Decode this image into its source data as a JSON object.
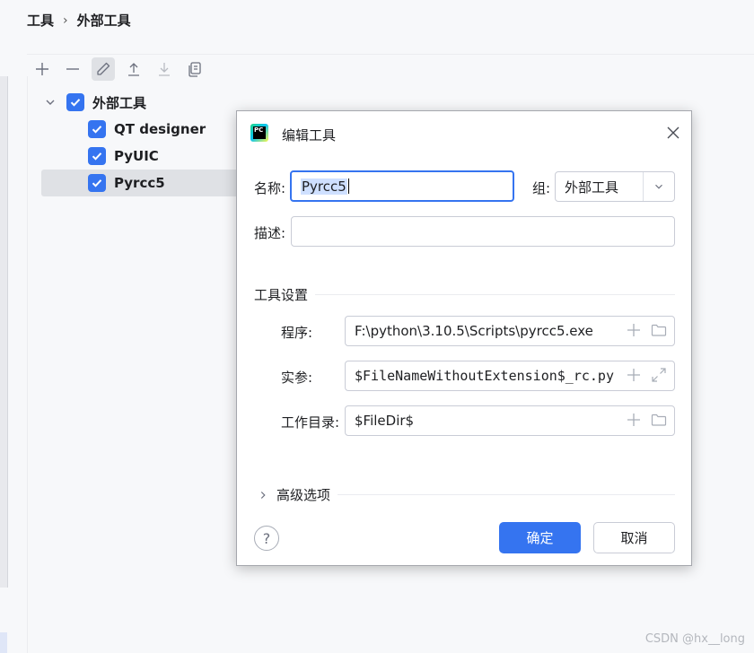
{
  "breadcrumb": {
    "root": "工具",
    "separator": "›",
    "current": "外部工具"
  },
  "toolbar": {
    "items": [
      "add-icon",
      "remove-icon",
      "edit-icon",
      "move-up-icon",
      "move-down-icon",
      "copy-icon"
    ]
  },
  "tree": {
    "group": {
      "label": "外部工具",
      "checked": true
    },
    "items": [
      {
        "label": "QT designer",
        "checked": true
      },
      {
        "label": "PyUIC",
        "checked": true
      },
      {
        "label": "Pyrcc5",
        "checked": true,
        "selected": true
      }
    ]
  },
  "dialog": {
    "title": "编辑工具",
    "name_label": "名称:",
    "name_value": "Pyrcc5",
    "group_label": "组:",
    "group_value": "外部工具",
    "desc_label": "描述:",
    "desc_value": "",
    "tool_settings_title": "工具设置",
    "program_label": "程序:",
    "program_value": "F:\\python\\3.10.5\\Scripts\\pyrcc5.exe",
    "args_label": "实参:",
    "args_value": "$FileNameWithoutExtension$_rc.py",
    "workdir_label": "工作目录:",
    "workdir_value": "$FileDir$",
    "advanced_label": "高级选项",
    "ok_label": "确定",
    "cancel_label": "取消",
    "help_glyph": "?"
  },
  "watermark": "CSDN @hx__long",
  "colors": {
    "accent": "#3574f0",
    "selection": "#dfe1e5"
  }
}
